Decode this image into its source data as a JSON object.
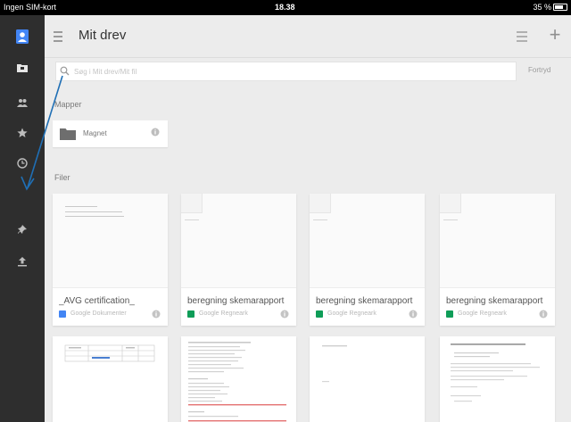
{
  "status_bar": {
    "carrier": "Ingen SIM-kort",
    "time": "18.38",
    "battery": "35 %"
  },
  "sidebar": {
    "items": [
      {
        "name": "account",
        "icon": "account-icon"
      },
      {
        "name": "my-drive",
        "icon": "drive-folder-icon"
      },
      {
        "name": "shared-with-me",
        "icon": "people-icon"
      },
      {
        "name": "starred",
        "icon": "star-icon"
      },
      {
        "name": "recent",
        "icon": "clock-icon"
      },
      {
        "name": "offline",
        "icon": "pin-icon"
      },
      {
        "name": "uploads",
        "icon": "upload-icon"
      }
    ]
  },
  "header": {
    "title": "Mit drev"
  },
  "search": {
    "placeholder": "Søg i Mit drev/Mit fil",
    "cancel_label": "Fortryd"
  },
  "sections": {
    "folders_label": "Mapper",
    "files_label": "Filer"
  },
  "folders": [
    {
      "name": "Magnet"
    }
  ],
  "files": [
    {
      "name": "_AVG certification_",
      "type": "Google Dokumenter",
      "type_color": "#4285f4"
    },
    {
      "name": "beregning skemarapport",
      "type": "Google Regneark",
      "type_color": "#0f9d58"
    },
    {
      "name": "beregning skemarapport",
      "type": "Google Regneark",
      "type_color": "#0f9d58"
    },
    {
      "name": "beregning skemarapport",
      "type": "Google Regneark",
      "type_color": "#0f9d58"
    }
  ],
  "colors": {
    "sidebar_bg": "#2e2e2e",
    "account_accent": "#4285f4",
    "arrow": "#1f6fb5",
    "docs": "#4285f4",
    "sheets": "#0f9d58"
  }
}
